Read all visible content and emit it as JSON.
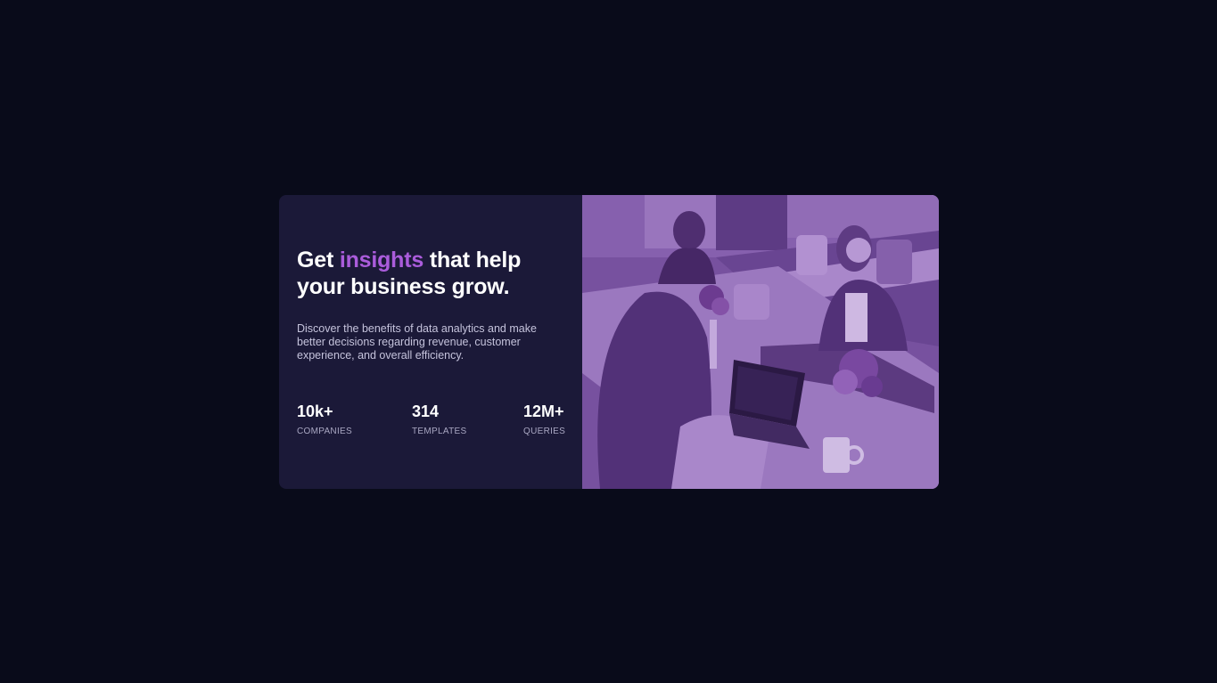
{
  "hero": {
    "headline_start": "Get ",
    "headline_accent": "insights",
    "headline_end": " that help your business grow.",
    "description": "Discover the benefits of data analytics and make better decisions regarding revenue, customer experience, and overall efficiency."
  },
  "stats": [
    {
      "value": "10k+",
      "label": "COMPANIES"
    },
    {
      "value": "314",
      "label": "TEMPLATES"
    },
    {
      "value": "12M+",
      "label": "QUERIES"
    }
  ],
  "image": {
    "description_icon": "office-photo"
  },
  "colors": {
    "page_bg": "#090b1a",
    "card_bg": "#1b1938",
    "accent": "#aa5cdb",
    "image_tint": "#6f4f95"
  }
}
